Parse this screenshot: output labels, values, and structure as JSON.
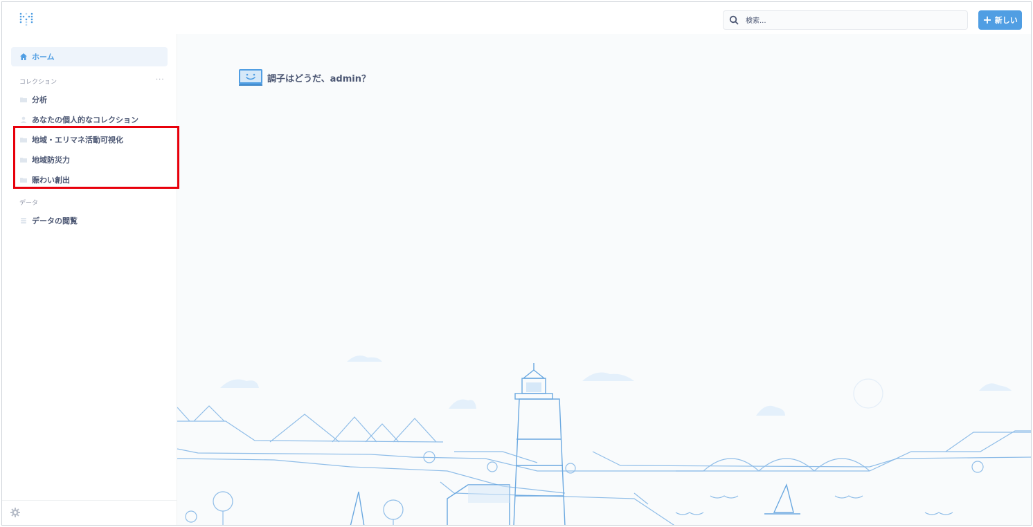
{
  "app": {
    "logo_name": "metabase-logo"
  },
  "header": {
    "search_placeholder": "検索...",
    "new_button_label": "新しい"
  },
  "sidebar": {
    "home_label": "ホーム",
    "collections_heading": "コレクション",
    "collections_more": "···",
    "collections": [
      {
        "label": "分析",
        "icon": "folder-icon"
      },
      {
        "label": "あなたの個人的なコレクション",
        "icon": "person-icon"
      },
      {
        "label": "地域・エリマネ活動可視化",
        "icon": "folder-icon"
      },
      {
        "label": "地域防災力",
        "icon": "folder-icon"
      },
      {
        "label": "賑わい創出",
        "icon": "folder-icon"
      }
    ],
    "data_heading": "データ",
    "data_items": [
      {
        "label": "データの閲覧",
        "icon": "database-icon"
      }
    ]
  },
  "main": {
    "greeting": "調子はどうだ、admin？"
  },
  "colors": {
    "brand": "#509ee3",
    "text": "#4c5773",
    "highlight": "#e8000b"
  }
}
